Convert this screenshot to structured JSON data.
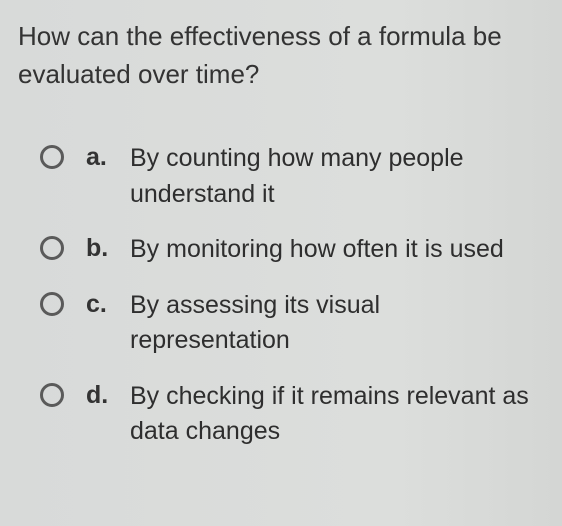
{
  "question": "How can the effectiveness of a formula be evaluated over time?",
  "options": [
    {
      "letter": "a.",
      "text": "By counting how many people understand it"
    },
    {
      "letter": "b.",
      "text": "By monitoring how often it is used"
    },
    {
      "letter": "c.",
      "text": "By assessing its visual representation"
    },
    {
      "letter": "d.",
      "text": "By checking if it remains relevant as data changes"
    }
  ]
}
